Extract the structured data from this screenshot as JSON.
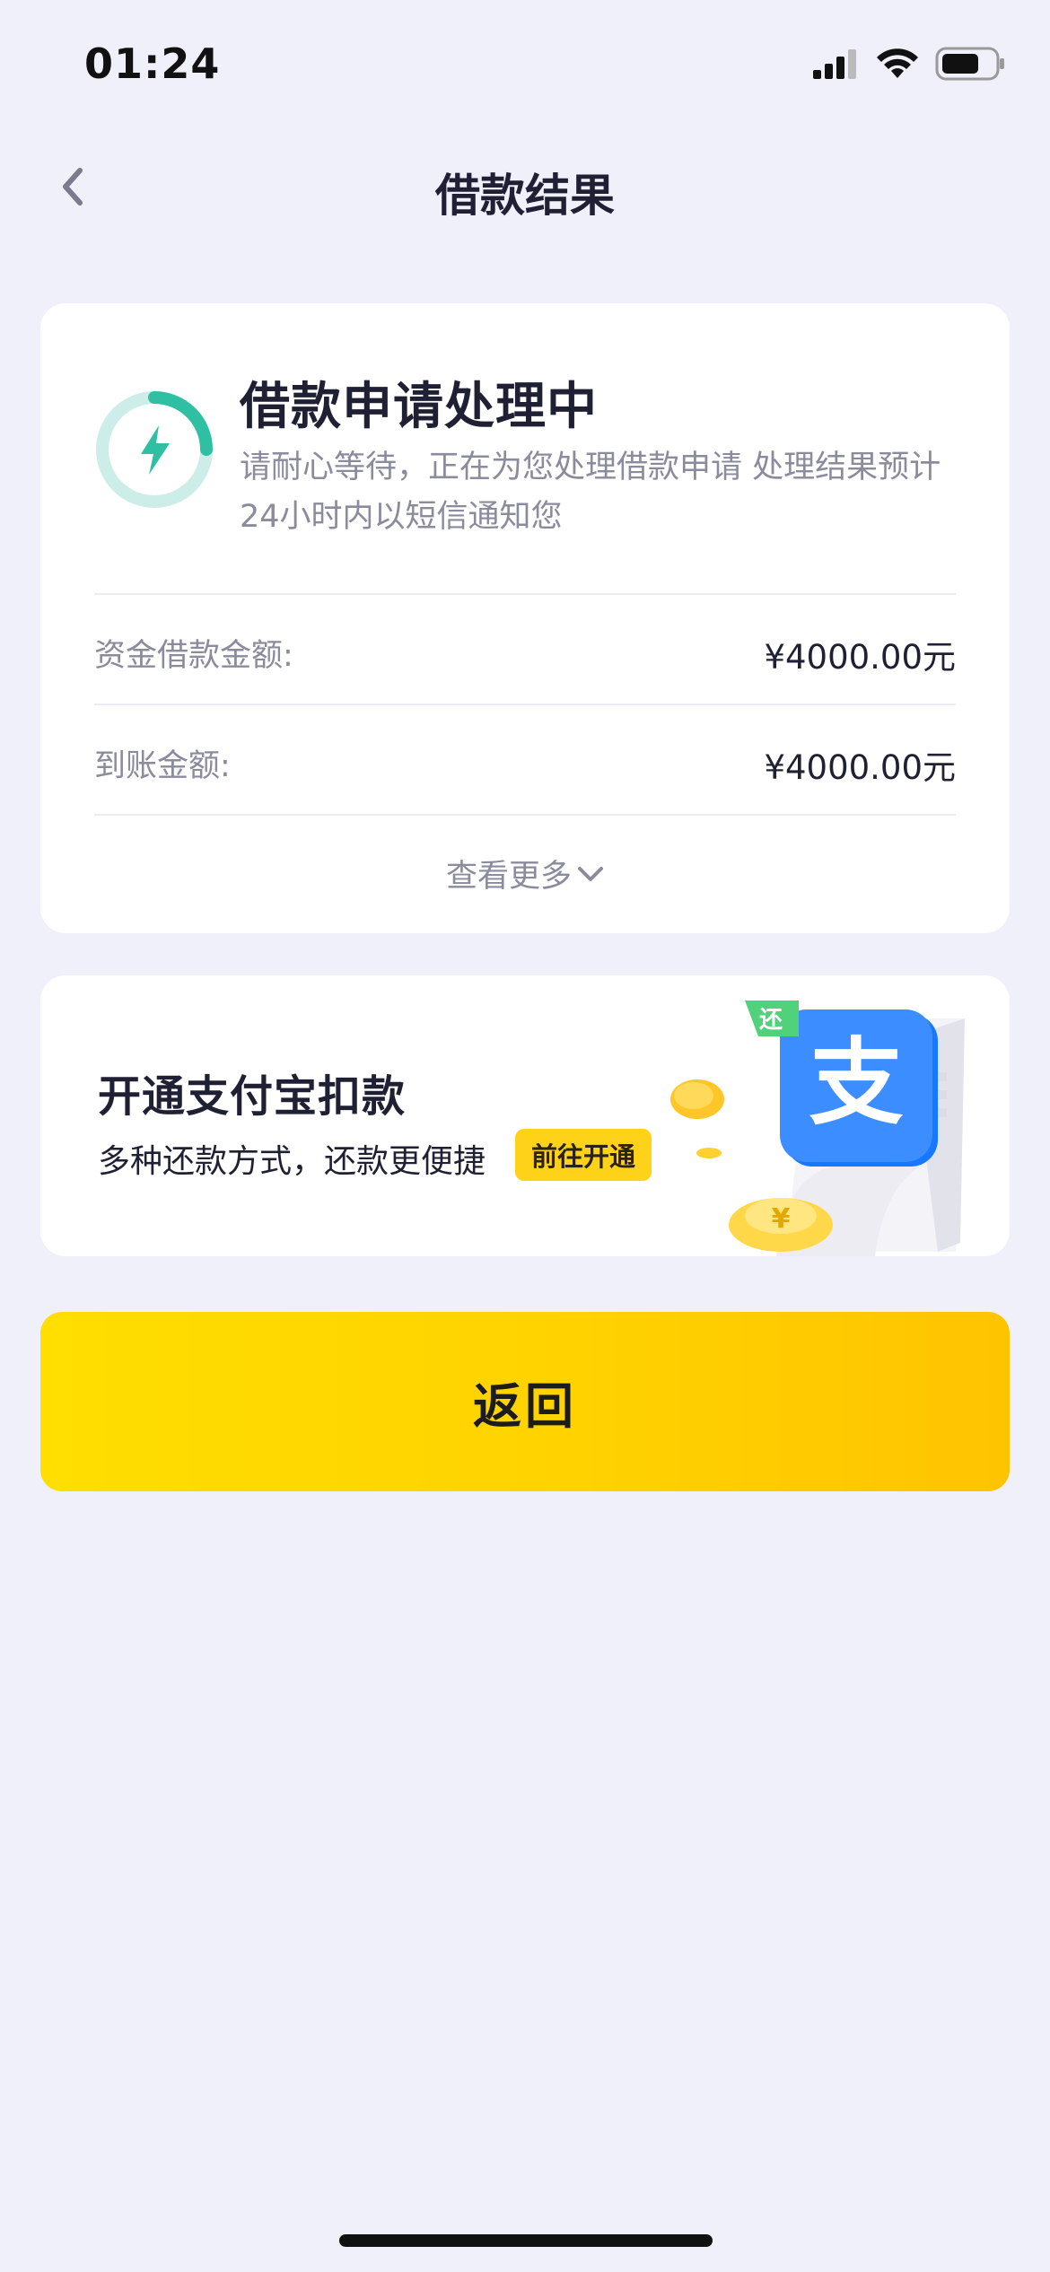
{
  "status_bar": {
    "time": "01:24",
    "icons": [
      "signal-icon",
      "wifi-icon",
      "battery-icon"
    ]
  },
  "nav": {
    "title": "借款结果",
    "back_icon": "chevron-left-icon"
  },
  "status_card": {
    "icon": "lightning-icon",
    "title": "借款申请处理中",
    "description": "请耐心等待，正在为您处理借款申请 处理结果预计24小时内以短信通知您",
    "rows": [
      {
        "label": "资金借款金额:",
        "value": "¥4000.00元"
      },
      {
        "label": "到账金额:",
        "value": "¥4000.00元"
      }
    ],
    "more_label": "查看更多"
  },
  "alipay_card": {
    "title": "开通支付宝扣款",
    "subtitle": "多种还款方式，还款更便捷",
    "cta_label": "前往开通",
    "art": {
      "badge_char": "支",
      "tag_char": "还"
    }
  },
  "return_button": {
    "label": "返回"
  },
  "colors": {
    "background": "#f0f0fa",
    "accent_yellow": "#ffd200",
    "status_green": "#2fc0a4",
    "alipay_blue": "#1677ff"
  }
}
